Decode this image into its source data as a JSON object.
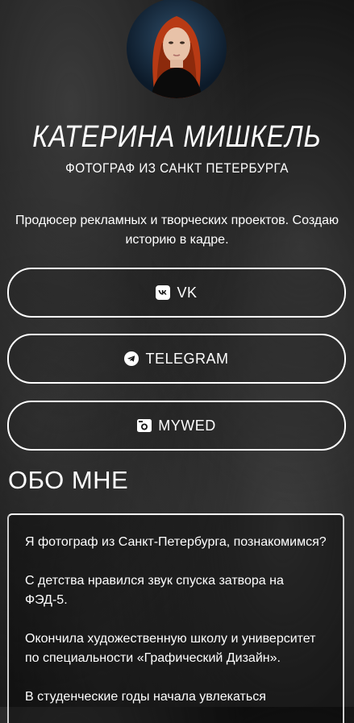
{
  "profile": {
    "name": "КАТЕРИНА МИШКЕЛЬ",
    "tagline": "ФОТОГРАФ ИЗ САНКТ ПЕТЕРБУРГА",
    "bio": "Продюсер рекламных и творческих проектов. Создаю историю в кадре."
  },
  "links": [
    {
      "label": "VK",
      "icon": "vk-icon"
    },
    {
      "label": "TELEGRAM",
      "icon": "telegram-icon"
    },
    {
      "label": "MYWED",
      "icon": "camera-icon"
    }
  ],
  "about": {
    "title": "ОБО МНЕ",
    "paragraphs": [
      "Я фотограф из Санкт-Петербурга, познакомимся?",
      "С детства нравился звук спуска затвора на ФЭД-5.",
      "Окончила художественную школу и университет по специальности «Графический Дизайн».",
      "В студенческие годы начала увлекаться"
    ]
  },
  "colors": {
    "accent": "#ffffff",
    "background": "#151515"
  }
}
